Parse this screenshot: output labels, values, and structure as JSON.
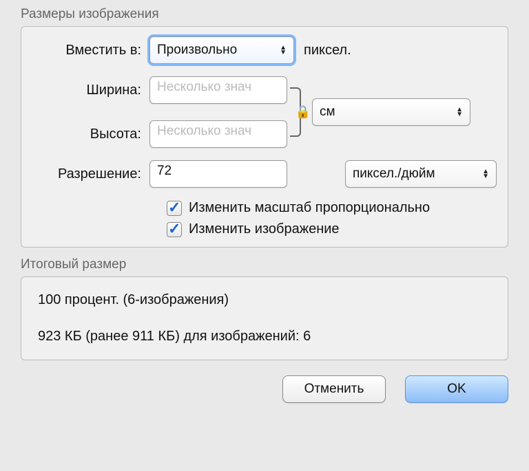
{
  "sections": {
    "image_dimensions_title": "Размеры изображения",
    "result_title": "Итоговый размер"
  },
  "fit": {
    "label": "Вместить в:",
    "value": "Произвольно",
    "unit_note": "пиксел."
  },
  "width": {
    "label": "Ширина:",
    "placeholder": "Несколько знач"
  },
  "height": {
    "label": "Высота:",
    "placeholder": "Несколько знач"
  },
  "dim_unit": {
    "value": "см"
  },
  "resolution": {
    "label": "Разрешение:",
    "value": "72",
    "unit": "пиксел./дюйм"
  },
  "checkboxes": {
    "scale_proportional": {
      "label": "Изменить масштаб пропорционально",
      "checked": true
    },
    "resample_image": {
      "label": "Изменить изображение",
      "checked": true
    }
  },
  "result": {
    "line1": "100 процент. (6-изображения)",
    "line2": "923 КБ (ранее 911 КБ) для изображений: 6"
  },
  "buttons": {
    "cancel": "Отменить",
    "ok": "OK"
  }
}
